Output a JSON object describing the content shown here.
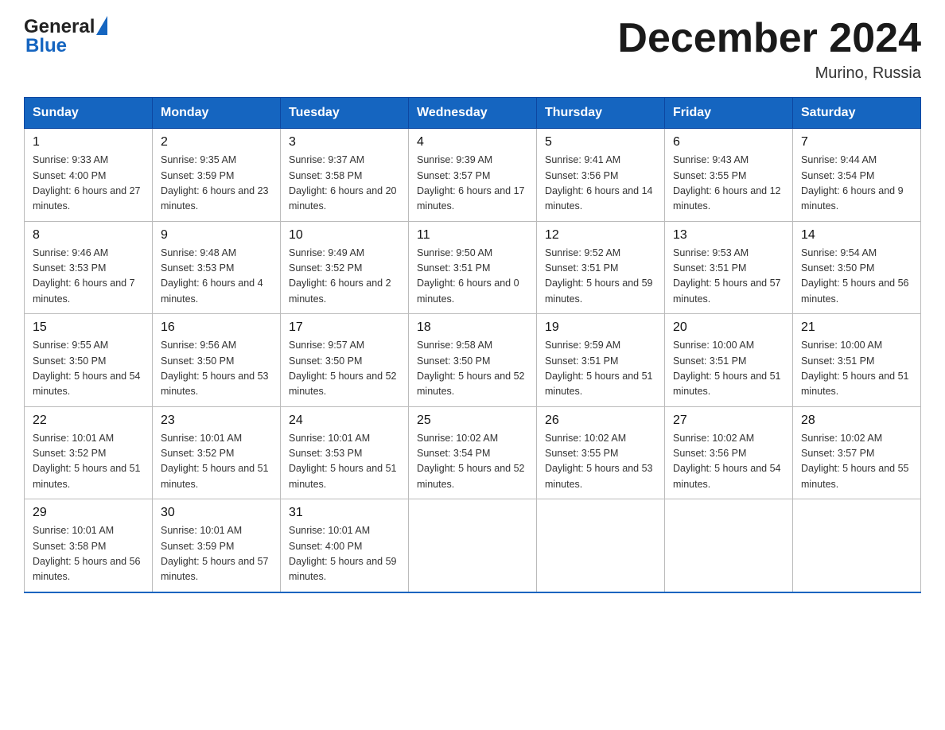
{
  "header": {
    "title": "December 2024",
    "subtitle": "Murino, Russia",
    "logo_general": "General",
    "logo_blue": "Blue"
  },
  "days_of_week": [
    "Sunday",
    "Monday",
    "Tuesday",
    "Wednesday",
    "Thursday",
    "Friday",
    "Saturday"
  ],
  "weeks": [
    [
      {
        "day": "1",
        "sunrise": "9:33 AM",
        "sunset": "4:00 PM",
        "daylight": "6 hours and 27 minutes."
      },
      {
        "day": "2",
        "sunrise": "9:35 AM",
        "sunset": "3:59 PM",
        "daylight": "6 hours and 23 minutes."
      },
      {
        "day": "3",
        "sunrise": "9:37 AM",
        "sunset": "3:58 PM",
        "daylight": "6 hours and 20 minutes."
      },
      {
        "day": "4",
        "sunrise": "9:39 AM",
        "sunset": "3:57 PM",
        "daylight": "6 hours and 17 minutes."
      },
      {
        "day": "5",
        "sunrise": "9:41 AM",
        "sunset": "3:56 PM",
        "daylight": "6 hours and 14 minutes."
      },
      {
        "day": "6",
        "sunrise": "9:43 AM",
        "sunset": "3:55 PM",
        "daylight": "6 hours and 12 minutes."
      },
      {
        "day": "7",
        "sunrise": "9:44 AM",
        "sunset": "3:54 PM",
        "daylight": "6 hours and 9 minutes."
      }
    ],
    [
      {
        "day": "8",
        "sunrise": "9:46 AM",
        "sunset": "3:53 PM",
        "daylight": "6 hours and 7 minutes."
      },
      {
        "day": "9",
        "sunrise": "9:48 AM",
        "sunset": "3:53 PM",
        "daylight": "6 hours and 4 minutes."
      },
      {
        "day": "10",
        "sunrise": "9:49 AM",
        "sunset": "3:52 PM",
        "daylight": "6 hours and 2 minutes."
      },
      {
        "day": "11",
        "sunrise": "9:50 AM",
        "sunset": "3:51 PM",
        "daylight": "6 hours and 0 minutes."
      },
      {
        "day": "12",
        "sunrise": "9:52 AM",
        "sunset": "3:51 PM",
        "daylight": "5 hours and 59 minutes."
      },
      {
        "day": "13",
        "sunrise": "9:53 AM",
        "sunset": "3:51 PM",
        "daylight": "5 hours and 57 minutes."
      },
      {
        "day": "14",
        "sunrise": "9:54 AM",
        "sunset": "3:50 PM",
        "daylight": "5 hours and 56 minutes."
      }
    ],
    [
      {
        "day": "15",
        "sunrise": "9:55 AM",
        "sunset": "3:50 PM",
        "daylight": "5 hours and 54 minutes."
      },
      {
        "day": "16",
        "sunrise": "9:56 AM",
        "sunset": "3:50 PM",
        "daylight": "5 hours and 53 minutes."
      },
      {
        "day": "17",
        "sunrise": "9:57 AM",
        "sunset": "3:50 PM",
        "daylight": "5 hours and 52 minutes."
      },
      {
        "day": "18",
        "sunrise": "9:58 AM",
        "sunset": "3:50 PM",
        "daylight": "5 hours and 52 minutes."
      },
      {
        "day": "19",
        "sunrise": "9:59 AM",
        "sunset": "3:51 PM",
        "daylight": "5 hours and 51 minutes."
      },
      {
        "day": "20",
        "sunrise": "10:00 AM",
        "sunset": "3:51 PM",
        "daylight": "5 hours and 51 minutes."
      },
      {
        "day": "21",
        "sunrise": "10:00 AM",
        "sunset": "3:51 PM",
        "daylight": "5 hours and 51 minutes."
      }
    ],
    [
      {
        "day": "22",
        "sunrise": "10:01 AM",
        "sunset": "3:52 PM",
        "daylight": "5 hours and 51 minutes."
      },
      {
        "day": "23",
        "sunrise": "10:01 AM",
        "sunset": "3:52 PM",
        "daylight": "5 hours and 51 minutes."
      },
      {
        "day": "24",
        "sunrise": "10:01 AM",
        "sunset": "3:53 PM",
        "daylight": "5 hours and 51 minutes."
      },
      {
        "day": "25",
        "sunrise": "10:02 AM",
        "sunset": "3:54 PM",
        "daylight": "5 hours and 52 minutes."
      },
      {
        "day": "26",
        "sunrise": "10:02 AM",
        "sunset": "3:55 PM",
        "daylight": "5 hours and 53 minutes."
      },
      {
        "day": "27",
        "sunrise": "10:02 AM",
        "sunset": "3:56 PM",
        "daylight": "5 hours and 54 minutes."
      },
      {
        "day": "28",
        "sunrise": "10:02 AM",
        "sunset": "3:57 PM",
        "daylight": "5 hours and 55 minutes."
      }
    ],
    [
      {
        "day": "29",
        "sunrise": "10:01 AM",
        "sunset": "3:58 PM",
        "daylight": "5 hours and 56 minutes."
      },
      {
        "day": "30",
        "sunrise": "10:01 AM",
        "sunset": "3:59 PM",
        "daylight": "5 hours and 57 minutes."
      },
      {
        "day": "31",
        "sunrise": "10:01 AM",
        "sunset": "4:00 PM",
        "daylight": "5 hours and 59 minutes."
      },
      null,
      null,
      null,
      null
    ]
  ],
  "labels": {
    "sunrise": "Sunrise:",
    "sunset": "Sunset:",
    "daylight": "Daylight:"
  }
}
